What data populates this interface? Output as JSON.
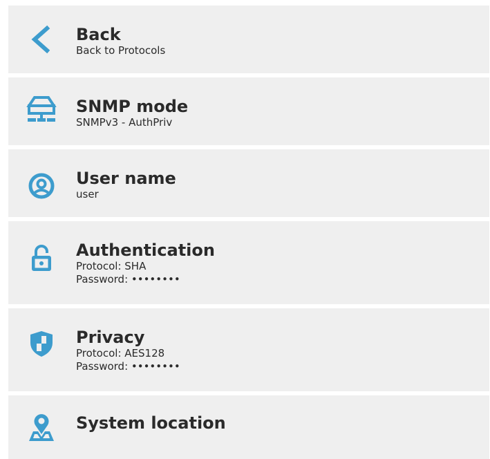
{
  "accent_color": "#3d9ccd",
  "items": [
    {
      "icon": "chevron-left-icon",
      "title": "Back",
      "lines": [
        "Back to Protocols"
      ]
    },
    {
      "icon": "network-switch-icon",
      "title": "SNMP mode",
      "lines": [
        "SNMPv3 - AuthPriv"
      ]
    },
    {
      "icon": "user-circle-icon",
      "title": "User name",
      "lines": [
        "user"
      ]
    },
    {
      "icon": "lock-icon",
      "title": "Authentication",
      "lines": [
        "Protocol: SHA",
        "Password: ••••••••"
      ]
    },
    {
      "icon": "shield-icon",
      "title": "Privacy",
      "lines": [
        "Protocol: AES128",
        "Password: ••••••••"
      ]
    },
    {
      "icon": "location-pin-icon",
      "title": "System location",
      "lines": []
    }
  ]
}
